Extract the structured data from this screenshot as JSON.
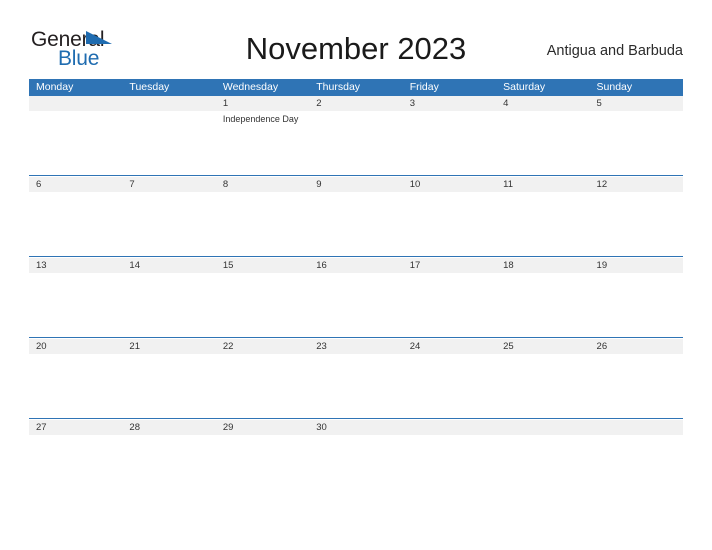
{
  "brand": {
    "word_one": "General",
    "word_two": "Blue",
    "flag_icon": "triangle-flag-icon",
    "accent_color": "#1f6cb0",
    "text_color": "#231f20"
  },
  "header": {
    "title": "November 2023",
    "country": "Antigua and Barbuda"
  },
  "theme": {
    "header_blue": "#2f74b5",
    "band_gray": "#f1f1f1",
    "rule_blue": "#2f74b5",
    "page_background": "#ffffff"
  },
  "calendar": {
    "weekdays": [
      "Monday",
      "Tuesday",
      "Wednesday",
      "Thursday",
      "Friday",
      "Saturday",
      "Sunday"
    ],
    "weeks": [
      {
        "days": [
          {
            "num": "",
            "event": ""
          },
          {
            "num": "",
            "event": ""
          },
          {
            "num": "1",
            "event": "Independence Day"
          },
          {
            "num": "2",
            "event": ""
          },
          {
            "num": "3",
            "event": ""
          },
          {
            "num": "4",
            "event": ""
          },
          {
            "num": "5",
            "event": ""
          }
        ]
      },
      {
        "days": [
          {
            "num": "6",
            "event": ""
          },
          {
            "num": "7",
            "event": ""
          },
          {
            "num": "8",
            "event": ""
          },
          {
            "num": "9",
            "event": ""
          },
          {
            "num": "10",
            "event": ""
          },
          {
            "num": "11",
            "event": ""
          },
          {
            "num": "12",
            "event": ""
          }
        ]
      },
      {
        "days": [
          {
            "num": "13",
            "event": ""
          },
          {
            "num": "14",
            "event": ""
          },
          {
            "num": "15",
            "event": ""
          },
          {
            "num": "16",
            "event": ""
          },
          {
            "num": "17",
            "event": ""
          },
          {
            "num": "18",
            "event": ""
          },
          {
            "num": "19",
            "event": ""
          }
        ]
      },
      {
        "days": [
          {
            "num": "20",
            "event": ""
          },
          {
            "num": "21",
            "event": ""
          },
          {
            "num": "22",
            "event": ""
          },
          {
            "num": "23",
            "event": ""
          },
          {
            "num": "24",
            "event": ""
          },
          {
            "num": "25",
            "event": ""
          },
          {
            "num": "26",
            "event": ""
          }
        ]
      },
      {
        "days": [
          {
            "num": "27",
            "event": ""
          },
          {
            "num": "28",
            "event": ""
          },
          {
            "num": "29",
            "event": ""
          },
          {
            "num": "30",
            "event": ""
          },
          {
            "num": "",
            "event": ""
          },
          {
            "num": "",
            "event": ""
          },
          {
            "num": "",
            "event": ""
          }
        ]
      }
    ]
  }
}
